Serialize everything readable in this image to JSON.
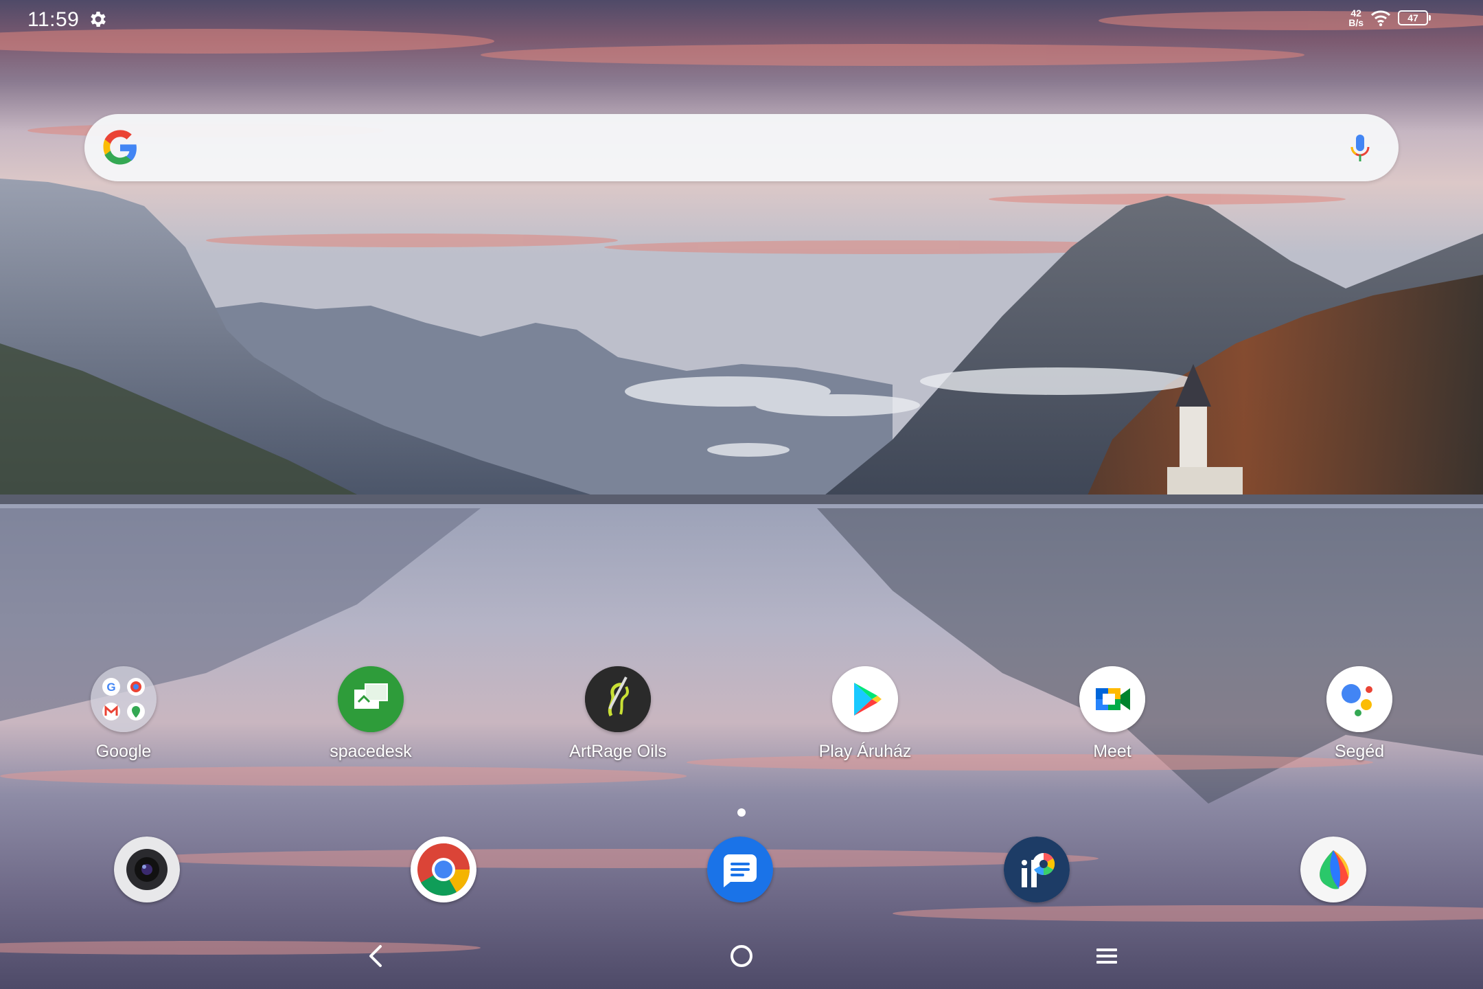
{
  "status_bar": {
    "time": "11:59",
    "net_speed_value": "42",
    "net_speed_unit": "B/s",
    "battery_level": "47",
    "icons": [
      "gear-icon",
      "wifi-icon",
      "battery-icon"
    ]
  },
  "search_bar": {
    "icons": [
      "google-g-icon",
      "microphone-icon"
    ]
  },
  "apps": [
    {
      "label": "Google",
      "icon": "google-folder-icon"
    },
    {
      "label": "spacedesk",
      "icon": "spacedesk-icon"
    },
    {
      "label": "ArtRage Oils",
      "icon": "artrage-icon"
    },
    {
      "label": "Play Áruház",
      "icon": "play-store-icon"
    },
    {
      "label": "Meet",
      "icon": "meet-icon"
    },
    {
      "label": "Segéd",
      "icon": "assistant-icon"
    }
  ],
  "dock": [
    "camera-icon",
    "chrome-icon",
    "messages-icon",
    "ibis-paint-icon",
    "color-app-icon"
  ],
  "pages": {
    "current": 1,
    "total": 1
  },
  "navigation": [
    "back-icon",
    "home-icon",
    "recents-icon"
  ],
  "colors": {
    "sky_top": "#5a4f6e",
    "sky_glow": "#e58a7a",
    "water": "#8a8fa8",
    "search_bg": "#f5f6f8"
  }
}
